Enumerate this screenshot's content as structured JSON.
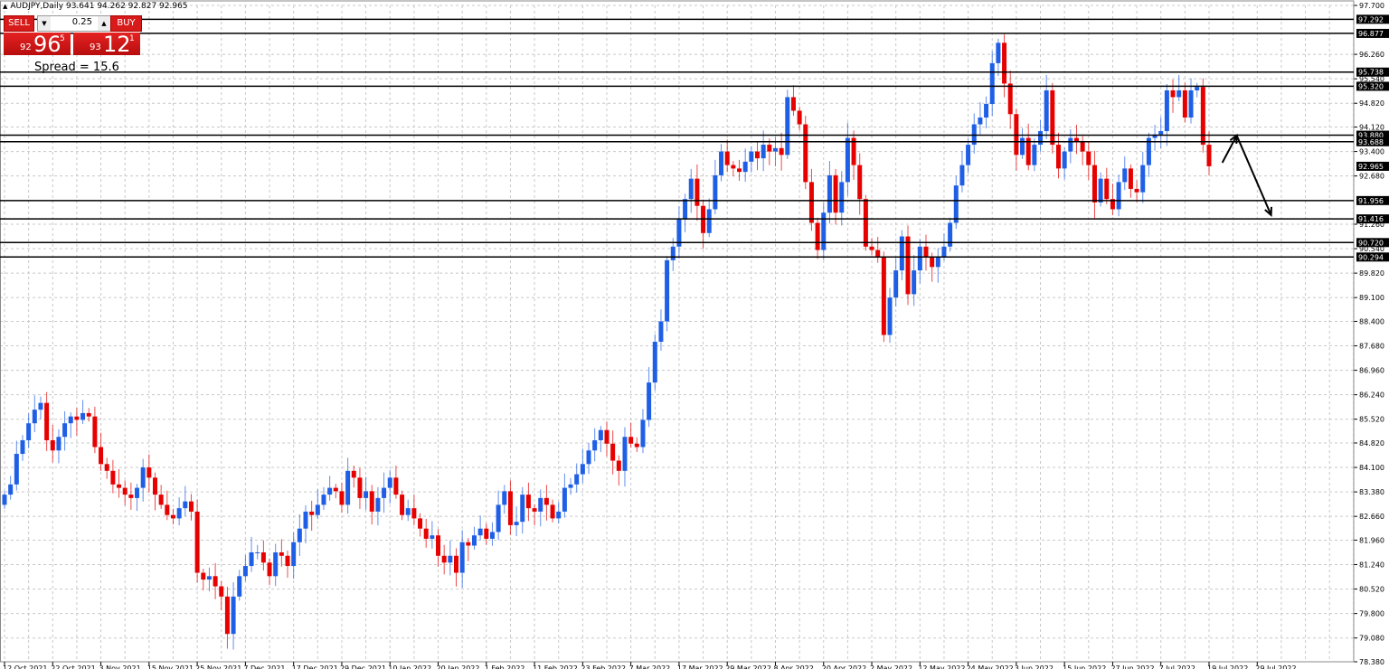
{
  "header": {
    "symbol": "AUDJPY,Daily",
    "ohlc": "93.641 94.262 92.827 92.965"
  },
  "trade_panel": {
    "sell_label": "SELL",
    "buy_label": "BUY",
    "lot": "0.25",
    "sell_price": {
      "prefix": "92",
      "main": "96",
      "pip": "5"
    },
    "buy_price": {
      "prefix": "93",
      "main": "12",
      "pip": "1"
    },
    "spread": "Spread = 15.6"
  },
  "colors": {
    "bull": "#1f5fe6",
    "bear": "#e60000",
    "grid": "#c8c8c8"
  },
  "chart_data": {
    "type": "candlestick",
    "title": "AUDJPY,Daily",
    "ylim": [
      78.38,
      97.7
    ],
    "note": "open of each candle = previous close",
    "closes": [
      83.3,
      83.6,
      84.5,
      84.9,
      85.4,
      85.8,
      86.0,
      84.9,
      84.6,
      85.0,
      85.4,
      85.6,
      85.5,
      85.7,
      85.6,
      84.7,
      84.2,
      84.0,
      83.6,
      83.5,
      83.3,
      83.2,
      83.5,
      84.1,
      83.8,
      83.3,
      83.0,
      82.7,
      82.6,
      82.9,
      83.1,
      82.8,
      81.0,
      80.8,
      80.9,
      80.6,
      80.3,
      79.2,
      80.3,
      80.9,
      81.2,
      81.6,
      81.6,
      81.3,
      80.9,
      81.6,
      81.5,
      81.2,
      81.9,
      82.3,
      82.8,
      82.7,
      83.0,
      83.3,
      83.5,
      83.4,
      83.0,
      84.0,
      83.8,
      83.2,
      83.4,
      82.8,
      83.2,
      83.5,
      83.8,
      83.3,
      82.7,
      82.9,
      82.6,
      82.3,
      82.0,
      82.1,
      81.5,
      81.3,
      81.5,
      81.0,
      81.9,
      81.8,
      82.1,
      82.3,
      82.0,
      82.2,
      83.0,
      83.4,
      82.4,
      82.5,
      83.3,
      82.9,
      82.8,
      83.2,
      83.0,
      82.6,
      82.8,
      83.5,
      83.6,
      83.9,
      84.2,
      84.6,
      84.9,
      85.2,
      84.8,
      84.3,
      84.0,
      85.0,
      84.8,
      84.7,
      85.5,
      86.6,
      87.8,
      88.4,
      90.2,
      90.6,
      91.4,
      92.0,
      92.6,
      91.8,
      91.0,
      91.7,
      92.7,
      93.4,
      93.0,
      92.9,
      92.8,
      93.1,
      93.4,
      93.2,
      93.6,
      93.4,
      93.5,
      93.3,
      95.0,
      94.6,
      94.2,
      92.5,
      91.3,
      90.5,
      91.6,
      92.7,
      91.6,
      92.5,
      93.8,
      93.0,
      92.0,
      90.6,
      90.5,
      90.3,
      88.0,
      89.1,
      89.9,
      90.9,
      89.2,
      89.9,
      90.6,
      90.3,
      90.0,
      90.3,
      90.6,
      91.3,
      92.4,
      93.0,
      93.6,
      94.2,
      94.4,
      94.8,
      96.0,
      96.6,
      95.4,
      94.5,
      93.3,
      93.8,
      93.0,
      93.6,
      94.0,
      95.2,
      93.6,
      92.9,
      93.4,
      93.8,
      93.7,
      93.4,
      93.0,
      91.9,
      92.6,
      92.0,
      91.7,
      92.5,
      92.9,
      92.3,
      92.2,
      93.0,
      93.8,
      93.9,
      94.0,
      95.2,
      95.0,
      95.2,
      94.4,
      95.2,
      95.3,
      93.6,
      92.965
    ],
    "x_tick_labels": [
      "12 Oct 2021",
      "22 Oct 2021",
      "3 Nov 2021",
      "15 Nov 2021",
      "25 Nov 2021",
      "7 Dec 2021",
      "17 Dec 2021",
      "29 Dec 2021",
      "10 Jan 2022",
      "20 Jan 2022",
      "1 Feb 2022",
      "11 Feb 2022",
      "23 Feb 2022",
      "7 Mar 2022",
      "17 Mar 2022",
      "29 Mar 2022",
      "8 Apr 2022",
      "20 Apr 2022",
      "2 May 2022",
      "12 May 2022",
      "24 May 2022",
      "3 Jun 2022",
      "15 Jun 2022",
      "27 Jun 2022",
      "7 Jul 2022",
      "19 Jul 2022",
      "29 Jul 2022"
    ],
    "x_tick_every": 8,
    "y_tick_labels": [
      "97.700",
      "96.260",
      "95.540",
      "94.820",
      "94.120",
      "93.400",
      "92.680",
      "91.260",
      "90.540",
      "89.820",
      "89.100",
      "88.400",
      "87.680",
      "86.960",
      "86.240",
      "85.520",
      "84.820",
      "84.100",
      "83.380",
      "82.660",
      "81.960",
      "81.240",
      "80.520",
      "79.800",
      "79.080",
      "78.380"
    ],
    "levels": [
      "97.292",
      "96.877",
      "95.738",
      "95.320",
      "93.880",
      "93.688",
      "91.956",
      "91.416",
      "90.720",
      "90.294"
    ],
    "current_price": "92.965",
    "annotation_arrows": [
      {
        "from": [
          202.2,
          93.07
        ],
        "to": [
          204.6,
          93.87
        ]
      },
      {
        "from": [
          204.6,
          93.87
        ],
        "to": [
          210.3,
          91.53
        ]
      }
    ]
  }
}
